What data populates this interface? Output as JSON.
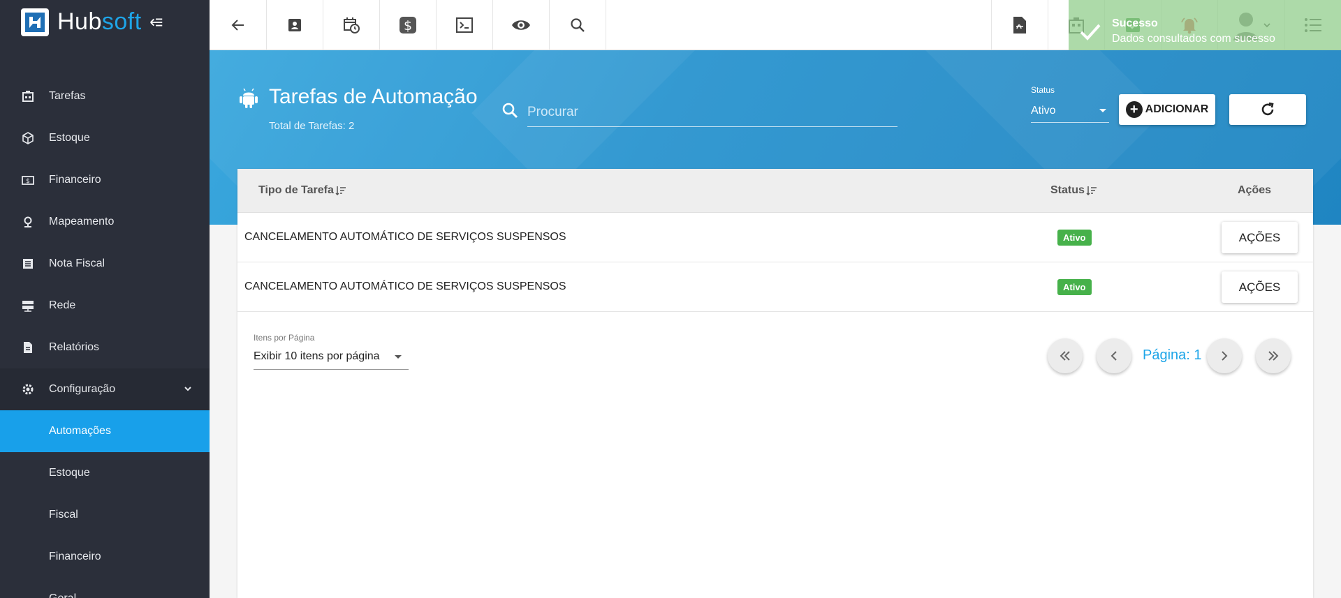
{
  "brand": {
    "name_part1": "Hub",
    "name_part2": "soft"
  },
  "sidebar": {
    "items": [
      {
        "label": "Tarefas",
        "icon": "tasks-icon"
      },
      {
        "label": "Estoque",
        "icon": "box-icon"
      },
      {
        "label": "Financeiro",
        "icon": "money-icon"
      },
      {
        "label": "Mapeamento",
        "icon": "map-pin-icon"
      },
      {
        "label": "Nota Fiscal",
        "icon": "receipt-icon"
      },
      {
        "label": "Rede",
        "icon": "server-icon"
      },
      {
        "label": "Relatórios",
        "icon": "document-icon"
      },
      {
        "label": "Configuração",
        "icon": "gear-icon",
        "expanded": true
      }
    ],
    "subitems": [
      {
        "label": "Automações",
        "active": true
      },
      {
        "label": "Estoque"
      },
      {
        "label": "Fiscal"
      },
      {
        "label": "Financeiro"
      },
      {
        "label": "Geral"
      }
    ]
  },
  "toast": {
    "title": "Sucesso",
    "message": "Dados consultados com sucesso"
  },
  "header": {
    "title": "Tarefas de Automação",
    "subtitle": "Total de Tarefas: 2",
    "search_placeholder": "Procurar",
    "status_label": "Status",
    "status_value": "Ativo",
    "add_label": "ADICIONAR"
  },
  "table": {
    "columns": {
      "type": "Tipo de Tarefa",
      "status": "Status",
      "actions": "Ações"
    },
    "rows": [
      {
        "type": "CANCELAMENTO AUTOMÁTICO DE SERVIÇOS SUSPENSOS",
        "status": "Ativo",
        "action": "AÇÕES"
      },
      {
        "type": "CANCELAMENTO AUTOMÁTICO DE SERVIÇOS SUSPENSOS",
        "status": "Ativo",
        "action": "AÇÕES"
      }
    ]
  },
  "pagination": {
    "per_page_label": "Itens por Página",
    "per_page_value": "Exibir 10 itens por página",
    "page_text": "Página: 1"
  },
  "colors": {
    "accent": "#1ea5e8",
    "sidebar": "#2b2f3a",
    "active_badge": "#46b14a"
  }
}
